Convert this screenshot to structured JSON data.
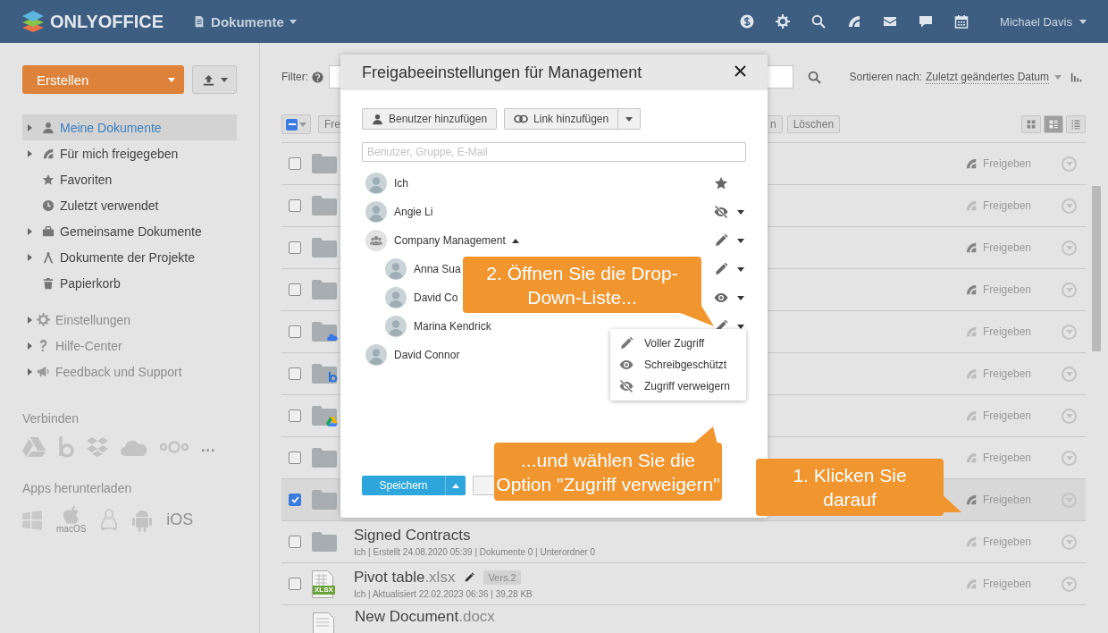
{
  "header": {
    "logo": "ONLYOFFICE",
    "module": "Dokumente",
    "user": "Michael Davis"
  },
  "sidebar": {
    "create": "Erstellen",
    "nav": [
      {
        "label": "Meine Dokumente",
        "expandable": true,
        "selected": true
      },
      {
        "label": "Für mich freigegeben",
        "expandable": true,
        "selected": false
      },
      {
        "label": "Favoriten",
        "expandable": false,
        "selected": false
      },
      {
        "label": "Zuletzt verwendet",
        "expandable": false,
        "selected": false
      },
      {
        "label": "Gemeinsame Dokumente",
        "expandable": true,
        "selected": false
      },
      {
        "label": "Dokumente der Projekte",
        "expandable": true,
        "selected": false
      },
      {
        "label": "Papierkorb",
        "expandable": false,
        "selected": false
      }
    ],
    "service": [
      {
        "label": "Einstellungen",
        "expandable": true
      },
      {
        "label": "Hilfe-Center",
        "expandable": true
      },
      {
        "label": "Feedback und Support",
        "expandable": true
      }
    ],
    "connect": {
      "title": "Verbinden",
      "more": "..."
    },
    "apps": {
      "title": "Apps herunterladen",
      "macos": "macOS",
      "ios": "iOS"
    }
  },
  "toolbar": {
    "select_all_indeterminate": true,
    "filter_label": "Filter:",
    "sort_label": "Sortieren nach:",
    "sort_value": "Zuletzt geändertes Datum",
    "buttons": [
      "Fre",
      "n",
      "Löschen"
    ],
    "views": [
      {
        "selected": false
      },
      {
        "selected": true
      },
      {
        "selected": false
      }
    ]
  },
  "files": [
    {
      "kind": "folder",
      "selected": false,
      "shared": true,
      "share": "Freigeben"
    },
    {
      "kind": "folder",
      "selected": false,
      "shared": false,
      "share": "Freigeben"
    },
    {
      "kind": "folder",
      "selected": false,
      "shared": true,
      "share": "Freigeben"
    },
    {
      "kind": "folder",
      "selected": false,
      "shared": true,
      "share": "Freigeben"
    },
    {
      "kind": "folder-onedrive",
      "selected": false,
      "shared": false,
      "share": "Freigeben"
    },
    {
      "kind": "folder-box",
      "selected": false,
      "shared": false,
      "share": "Freigeben"
    },
    {
      "kind": "folder-gdrive",
      "selected": false,
      "shared": false,
      "share": "Freigeben"
    },
    {
      "kind": "folder",
      "selected": false,
      "shared": false,
      "share": "Freigeben"
    },
    {
      "kind": "folder",
      "selected": true,
      "shared": true,
      "share": "Freigeben"
    },
    {
      "kind": "folder",
      "selected": false,
      "shared": false,
      "share": "Freigeben",
      "name": "Signed Contracts",
      "meta": "Ich | Erstellt 24.08.2020 05:39 | Dokumente 0 | Unterordner 0"
    },
    {
      "kind": "spreadsheet",
      "selected": false,
      "shared": false,
      "share": "Freigeben",
      "name": "Pivot table",
      "ext": ".xlsx",
      "icon_label": "XLSX",
      "version": "Vers.2",
      "meta": "Ich | Aktualisiert 22.02.2023 06:36 | 39,28 KB"
    },
    {
      "kind": "document",
      "name": "New Document",
      "ext": ".docx"
    }
  ],
  "dialog": {
    "title": "Freigabeeinstellungen für Management",
    "add_user": "Benutzer hinzufügen",
    "add_link": "Link hinzufügen",
    "placeholder": "Benutzer, Gruppe, E-Mail",
    "entries": [
      {
        "name": "Ich",
        "kind": "user",
        "access": {
          "kind": "owner"
        }
      },
      {
        "name": "Angie Li",
        "kind": "user",
        "access": {
          "kind": "deny"
        }
      },
      {
        "name": "Company Management",
        "kind": "group",
        "access": {
          "kind": "full"
        },
        "expanded": true,
        "children": [
          {
            "name": "Anna Sua",
            "kind": "user",
            "access": {
              "kind": "full"
            }
          },
          {
            "name": "David Co",
            "kind": "user",
            "access": {
              "kind": "read"
            }
          },
          {
            "name": "Marina Kendrick",
            "kind": "user",
            "access": {
              "kind": "full"
            }
          }
        ]
      },
      {
        "name": "David Connor",
        "kind": "user"
      }
    ],
    "menu": [
      {
        "label": "Voller Zugriff",
        "kind": "full"
      },
      {
        "label": "Schreibgeschützt",
        "kind": "read"
      },
      {
        "label": "Zugriff verweigern",
        "kind": "deny"
      }
    ],
    "save": "Speichern"
  },
  "callouts": [
    {
      "text": "1. Klicken Sie darauf"
    },
    {
      "text": "2. Öffnen Sie die Drop-Down-Liste..."
    },
    {
      "text": "...und wählen Sie die Option \"Zugriff verweigern\""
    }
  ]
}
